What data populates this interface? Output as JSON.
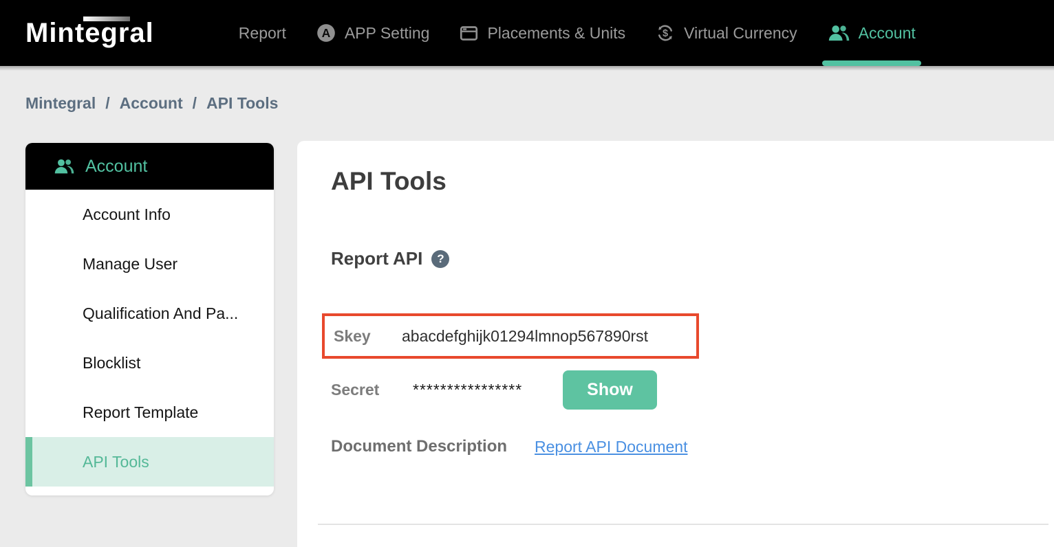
{
  "nav": {
    "logo": "Mintegral",
    "items": [
      {
        "label": "Report",
        "icon": "grid-icon",
        "active": false
      },
      {
        "label": "APP Setting",
        "icon": "app-store-icon",
        "active": false
      },
      {
        "label": "Placements & Units",
        "icon": "window-icon",
        "active": false
      },
      {
        "label": "Virtual Currency",
        "icon": "currency-icon",
        "active": false
      },
      {
        "label": "Account",
        "icon": "users-icon",
        "active": true
      }
    ]
  },
  "breadcrumb": {
    "separator": "/",
    "items": [
      "Mintegral",
      "Account",
      "API Tools"
    ]
  },
  "sidebar": {
    "header": {
      "label": "Account",
      "icon": "users-icon"
    },
    "items": [
      {
        "label": "Account Info",
        "active": false
      },
      {
        "label": "Manage User",
        "active": false
      },
      {
        "label": "Qualification And Pa...",
        "active": false
      },
      {
        "label": "Blocklist",
        "active": false
      },
      {
        "label": "Report Template",
        "active": false
      },
      {
        "label": "API Tools",
        "active": true
      }
    ]
  },
  "main": {
    "title": "API Tools",
    "section": {
      "title": "Report API",
      "help": "?",
      "skey": {
        "label": "Skey",
        "value": "abacdefghijk01294lmnop567890rst"
      },
      "secret": {
        "label": "Secret",
        "value": "****************",
        "button_label": "Show"
      },
      "document": {
        "label": "Document Description",
        "link_label": "Report API Document"
      }
    }
  },
  "colors": {
    "accent_green": "#52c1a1",
    "button_green": "#5ec3a1",
    "highlight_red": "#e8492d",
    "link_blue": "#4a90e2",
    "topbar_bg": "#000000",
    "sidebar_active_bg": "#d9efe7",
    "page_bg": "#ebebeb"
  }
}
